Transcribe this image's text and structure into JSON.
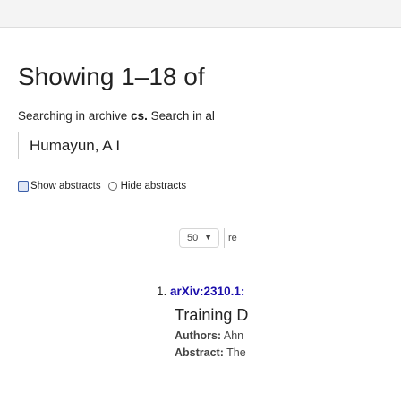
{
  "header": {
    "title": "Showing 1–18 of"
  },
  "search": {
    "prefix": "Searching in archive ",
    "archive": "cs.",
    "suffix": " Search in al",
    "query": "Humayun, A I"
  },
  "abstract_toggle": {
    "show_label": "Show abstracts",
    "hide_label": "Hide abstracts",
    "show_checked": true
  },
  "controls": {
    "page_size_value": "50",
    "results_label": "re"
  },
  "results": [
    {
      "number": "1.",
      "arxiv_id": "arXiv:2310.1:",
      "title": "Training D",
      "authors_label": "Authors:",
      "authors": "Ahn",
      "abstract_label": "Abstract:",
      "abstract": "The"
    }
  ]
}
